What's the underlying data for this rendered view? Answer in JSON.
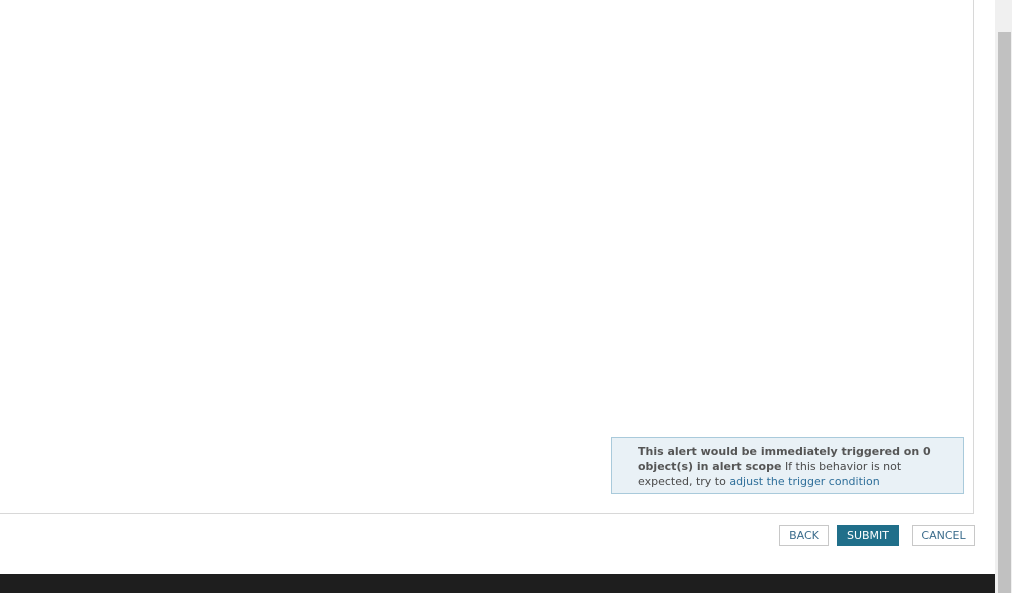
{
  "alert": {
    "bold_text": "This alert would be immediately triggered on 0 object(s) in alert scope",
    "normal_text": "If this behavior is not expected, try to",
    "link_text": "adjust the trigger condition"
  },
  "buttons": {
    "back_label": "BACK",
    "submit_label": "SUBMIT",
    "cancel_label": "CANCEL"
  },
  "colors": {
    "accent": "#206f8a",
    "link": "#2f6f9a",
    "notice_bg": "#e9f1f6",
    "notice_border": "#a9cadb",
    "footer": "#1e1e1e"
  }
}
